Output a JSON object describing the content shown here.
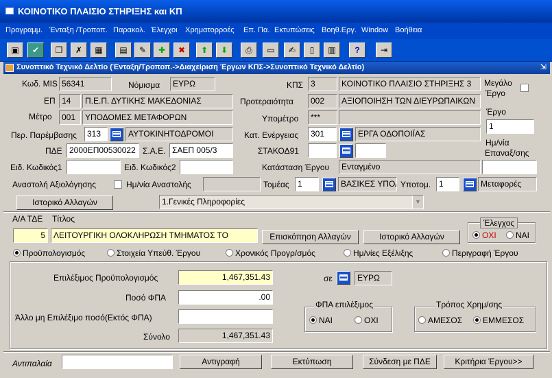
{
  "app": {
    "title": "ΚΟΙΝΟΤΙΚΟ ΠΛΑΙΣΙΟ ΣΤΗΡΙΞΗΣ και ΚΠ"
  },
  "menu": [
    "Προγραμμ.",
    "Ένταξη /Τροποπ.",
    "Παρακολ.",
    "Έλεγχοι",
    "Χρηματορροές",
    "Επ. Πα.",
    "Εκτυπώσεις",
    "Βοηθ.Εργ.",
    "Window",
    "Βοήθεια"
  ],
  "toolbar_icons": [
    "save-icon",
    "check-icon",
    "copy-icon",
    "clear-icon",
    "calculator-icon",
    "form-icon",
    "edit-icon",
    "add-icon",
    "delete-icon",
    "arrow-up-icon",
    "arrow-down-icon",
    "print-icon",
    "screen-icon",
    "notes-icon",
    "document-icon",
    "paste-icon",
    "help-icon",
    "exit-icon"
  ],
  "window": {
    "title": "Συνοπτικό Τεχνικό Δελτίο (Ένταξη/Τροποπ.->Διαχείριση Έργων ΚΠΣ->Συνοπτικό Τεχνικό Δελτίο)"
  },
  "form": {
    "mis_label": "Κωδ. MIS",
    "mis_value": "56341",
    "currency_label": "Νόμισμα",
    "currency_value": "ΕΥΡΩ",
    "kps_label": "ΚΠΣ",
    "kps_code": "3",
    "kps_name": "ΚΟΙΝΟΤΙΚΟ ΠΛΑΙΣΙΟ ΣΤΗΡΙΞΗΣ 3",
    "big_project_label_1": "Μεγάλο",
    "big_project_label_2": "Έργο",
    "ep_label": "ΕΠ",
    "ep_code": "14",
    "ep_name": "Π.Ε.Π. ΔΥΤΙΚΗΣ ΜΑΚΕΔΟΝΙΑΣ",
    "priority_label": "Προτεραιότητα",
    "priority_code": "002",
    "priority_name": "ΑΞΙΟΠΟΙΗΣΗ ΤΩΝ ΔΙΕΥΡΩΠΑΙΚΩΝ",
    "project_label": "Έργο",
    "project_value": "1",
    "measure_label": "Μέτρο",
    "measure_code": "001",
    "measure_name": "ΥΠΟΔΟΜΕΣ ΜΕΤΑΦΟΡΩΝ",
    "submeasure_label": "Υπομέτρο",
    "submeasure_code": "***",
    "intervention_label": "Περ. Παρέμβασης",
    "intervention_code": "313",
    "intervention_name": "ΑΥΤΟΚΙΝΗΤΟΔΡΟΜΟΙ",
    "action_cat_label": "Κατ. Ενέργειας",
    "action_cat_code": "301",
    "action_cat_name": "ΕΡΓΑ ΟΔΟΠΟΙΪΑΣ",
    "date_label_1": "Ημ/νία",
    "date_label_2": "Επαναξ/σης",
    "pde_label": "ΠΔΕ",
    "pde_value": "2000ΕΠ00530022",
    "sae_label": "Σ.Α.Ε.",
    "sae_value": "ΣΑΕΠ 005/3",
    "stakod_label": "ΣΤΑΚΟΔ91",
    "special_code1_label": "Ειδ. Κωδικός1",
    "special_code2_label": "Ειδ. Κωδικός2",
    "status_label": "Κατάσταση Έργου",
    "status_value": "Ενταγμένο",
    "suspend_label": "Αναστολή Αξιολόγησης",
    "suspend_date_label": "Ημ/νία Αναστολής",
    "sector_label": "Τομέας",
    "sector_code": "1",
    "sector_name": "ΒΑΣΙΚΕΣ ΥΠΟΔΟΜΕΣ",
    "subsector_label": "Υποτομ.",
    "subsector_code": "1",
    "subsector_name": "Μεταφορές",
    "history_button": "Ιστορικό Αλλαγών",
    "tab_select": "1.Γενικές Πληροφορίες"
  },
  "tde": {
    "aa_label": "Α/Α ΤΔΕ",
    "title_label": "Τίτλος",
    "aa_value": "5",
    "title_value": "ΛΕΙΤΟΥΡΓΙΚΗ ΟΛΟΚΛΗΡΩΣΗ ΤΜΗΜΑΤΟΣ ΤΟ",
    "review_button": "Επισκόπηση Αλλαγών",
    "history_button": "Ιστορικό Αλλαγών",
    "check_group": "Έλεγχος",
    "check_no": "ΟΧΙ",
    "check_yes": "ΝΑΙ"
  },
  "tabs": [
    "Προϋπολογισμός",
    "Στοιχεία Υπεύθ. Έργου",
    "Χρονικός Προγρ/σμός",
    "Ημ/νίες Εξέλιξης",
    "Περιγραφή Έργου"
  ],
  "budget": {
    "eligible_label": "Επιλέξιμος Προϋπολογισμός",
    "eligible_value": "1,467,351.43",
    "vat_label": "Ποσό  ΦΠΑ",
    "vat_value": ".00",
    "other_label": "Άλλο μη Επιλέξιμο ποσό(Εκτός ΦΠΑ)",
    "other_value": "",
    "total_label": "Σύνολο",
    "total_value": "1,467,351.43",
    "in_label": "σε",
    "in_value": "ΕΥΡΩ",
    "vat_group": "ΦΠΑ επιλέξιμος",
    "vat_yes": "ΝΑΙ",
    "vat_no": "ΟΧΙ",
    "finance_group": "Τρόπος Χρημ/σης",
    "finance_direct": "ΑΜΕΣΟΣ",
    "finance_indirect": "ΕΜΜΕΣΟΣ"
  },
  "footer": {
    "anti_label": "Αντιπαλαία",
    "copy_button": "Αντιγραφή",
    "print_button": "Εκτύπωση",
    "link_button": "Σύνδεση με ΠΔΕ",
    "criteria_button": "Κριτήρια Έργου>>"
  }
}
